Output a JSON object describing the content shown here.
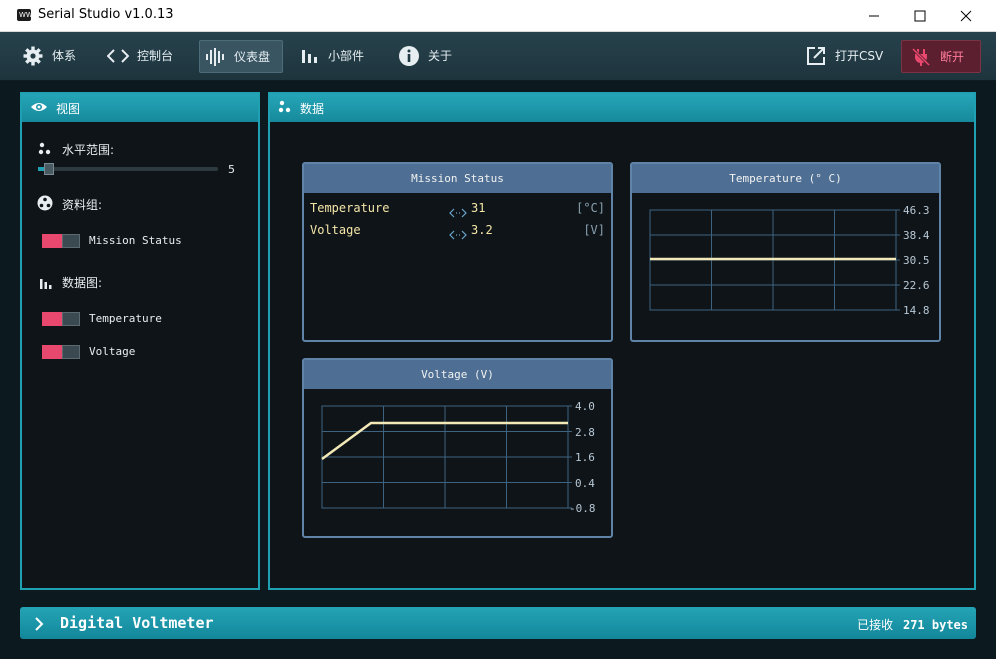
{
  "window": {
    "title": "Serial Studio v1.0.13",
    "icon_text": "WW"
  },
  "toolbar": {
    "items": [
      {
        "label": "体系"
      },
      {
        "label": "控制台"
      },
      {
        "label": "仪表盘"
      },
      {
        "label": "小部件"
      },
      {
        "label": "关于"
      }
    ],
    "open_csv": "打开CSV",
    "disconnect": "断开",
    "accent": "#e8476e"
  },
  "view_panel": {
    "title": "视图",
    "range_label": "水平范围:",
    "range_value": "5",
    "groups_label": "资料组:",
    "groups": [
      {
        "label": "Mission Status"
      }
    ],
    "plots_label": "数据图:",
    "plots": [
      {
        "label": "Temperature"
      },
      {
        "label": "Voltage"
      }
    ]
  },
  "data_panel": {
    "title": "数据",
    "mission": {
      "title": "Mission Status",
      "rows": [
        {
          "name": "Temperature",
          "value": "31",
          "unit": "[°C]"
        },
        {
          "name": "Voltage",
          "value": "3.2",
          "unit": "[V]"
        }
      ]
    },
    "temp_plot": {
      "title": "Temperature (° C)",
      "ticks": [
        "46.3",
        "38.4",
        "30.5",
        "22.6",
        "14.8"
      ]
    },
    "volt_plot": {
      "title": "Voltage (V)",
      "ticks": [
        "4.0",
        "2.8",
        "1.6",
        "0.4",
        "-0.8"
      ]
    }
  },
  "footer": {
    "project": "Digital Voltmeter",
    "received_label": "已接收",
    "received_value": "271 bytes"
  }
}
